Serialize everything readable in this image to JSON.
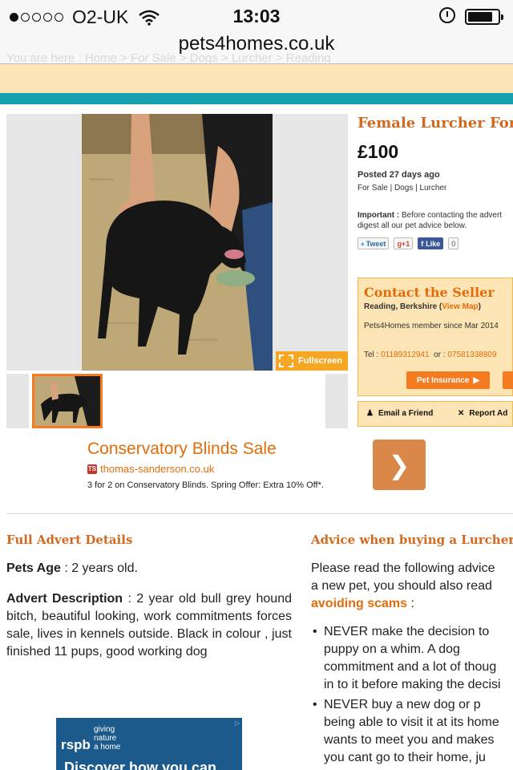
{
  "status_bar": {
    "carrier": "O2-UK",
    "time": "13:03",
    "signal_dots_filled": 1,
    "signal_dots_total": 5
  },
  "browser": {
    "url": "pets4homes.co.uk",
    "breadcrumb_ghost": "You are here : Home > For Sale > Dogs > Lurcher > Reading"
  },
  "gallery": {
    "fullscreen_label": "Fullscreen"
  },
  "listing": {
    "title": "Female Lurcher For",
    "price": "£100",
    "posted": "Posted 27 days ago",
    "categories": "For Sale | Dogs | Lurcher",
    "important_label": "Important :",
    "important_line1": " Before contacting the advert",
    "important_line2": "digest all our pet advice below."
  },
  "social": {
    "tweet": "Tweet",
    "gplus": "g+1",
    "like": "Like",
    "like_count": "0"
  },
  "seller": {
    "title": "Contact the Seller",
    "location": "Reading, Berkshire",
    "view_map": "View Map",
    "member_since": "Pets4Homes member since Mar 2014",
    "tel_label": "Tel :",
    "tel1": "01189312941",
    "or": "or :",
    "tel2": "07581338809",
    "insurance_button": "Pet Insurance",
    "email_friend": "Email a Friend",
    "report_ad": "Report Ad"
  },
  "ad": {
    "title": "Conservatory Blinds Sale",
    "domain": "thomas-sanderson.co.uk",
    "text": "3 for 2 on Conservatory Blinds. Spring Offer: Extra 10% Off*."
  },
  "details": {
    "section_title": "Full Advert Details",
    "age_label": "Pets Age",
    "age_value": " : 2 years old.",
    "desc_label": "Advert Description",
    "desc_value": " : 2 year old bull grey hound bitch, beautiful looking, work commitments forces sale, lives in kennels outside. Black in colour , just finished 11 pups, good working dog"
  },
  "advice": {
    "section_title": "Advice when buying a Lurcher",
    "line1": "Please read the following advice",
    "line2": "a new pet, you should also read",
    "link": "avoiding scams",
    "link_suffix": " :",
    "bullet1": [
      "NEVER make the decision to",
      "puppy  on  a  whim.  A  dog",
      "commitment and a lot of thoug",
      "in to it before making the decisi"
    ],
    "bullet2": [
      "NEVER  buy  a  new  dog  or  p",
      "being able to visit it at its home",
      "wants to meet you and makes",
      "you cant go to their home, ju"
    ]
  },
  "rspb": {
    "logo": "rspb",
    "tagline": [
      "giving",
      "nature",
      "a home"
    ],
    "bottom": "Discover how you can"
  },
  "colors": {
    "accent_orange": "#e36c0a",
    "teal": "#17a0b0",
    "panel_bg": "#fde4b4"
  }
}
